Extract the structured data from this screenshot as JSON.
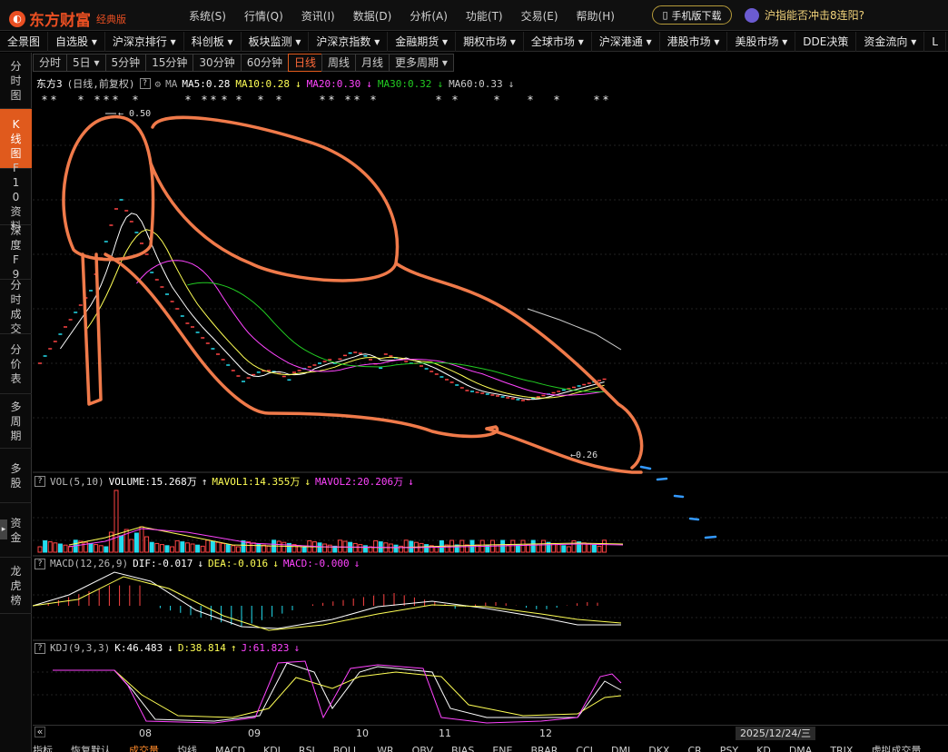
{
  "app": {
    "logo": "东方财富",
    "logo_sub": "经典版"
  },
  "menu": [
    "系统(S)",
    "行情(Q)",
    "资讯(I)",
    "数据(D)",
    "分析(A)",
    "功能(T)",
    "交易(E)",
    "帮助(H)"
  ],
  "mobile_download": "手机版下载",
  "news_headline": "沪指能否冲击8连阳?",
  "navbar": [
    "全景图",
    "自选股 ▾",
    "沪深京排行 ▾",
    "科创板 ▾",
    "板块监测 ▾",
    "沪深京指数 ▾",
    "金融期货 ▾",
    "期权市场 ▾",
    "全球市场 ▾",
    "沪深港通 ▾",
    "港股市场 ▾",
    "美股市场 ▾",
    "DDE决策",
    "资金流向 ▾",
    "L"
  ],
  "left_tabs": [
    {
      "label": "分时图",
      "active": false
    },
    {
      "label": "K线图",
      "active": true
    },
    {
      "label": "F10资料",
      "active": false
    },
    {
      "label": "深度F9",
      "active": false
    },
    {
      "label": "分时成交",
      "active": false
    },
    {
      "label": "分价表",
      "active": false
    },
    {
      "label": "多周期",
      "active": false
    },
    {
      "label": "多股",
      "active": false
    },
    {
      "label": "资金",
      "active": false
    },
    {
      "label": "龙虎榜",
      "active": false
    }
  ],
  "periods": [
    {
      "label": "分时",
      "active": false
    },
    {
      "label": "5日 ▾",
      "active": false
    },
    {
      "label": "5分钟",
      "active": false
    },
    {
      "label": "15分钟",
      "active": false
    },
    {
      "label": "30分钟",
      "active": false
    },
    {
      "label": "60分钟",
      "active": false
    },
    {
      "label": "日线",
      "active": true
    },
    {
      "label": "周线",
      "active": false
    },
    {
      "label": "月线",
      "active": false
    },
    {
      "label": "更多周期 ▾",
      "active": false
    }
  ],
  "stock": {
    "name": "东方3",
    "mode": "(日线,前复权)",
    "help": "?",
    "ma_label": "MA",
    "ma": [
      {
        "label": "MA5:0.28",
        "color": "#ffffff",
        "arrow": ""
      },
      {
        "label": "MA10:0.28",
        "color": "#ffff55",
        "arrow": "↓"
      },
      {
        "label": "MA20:0.30",
        "color": "#ff44ff",
        "arrow": "↓"
      },
      {
        "label": "MA30:0.32",
        "color": "#22cc22",
        "arrow": "↓"
      },
      {
        "label": "MA60:0.33",
        "color": "#cccccc",
        "arrow": "↓"
      }
    ]
  },
  "price_labels": {
    "high": "0.50",
    "low": "0.26"
  },
  "price_extremes": {
    "high": 0.5,
    "low": 0.26
  },
  "volume": {
    "label": "VOL(5,10)",
    "volume": "VOLUME:15.268万",
    "volume_arrow": "↑",
    "mavol1": "MAVOL1:14.355万",
    "mavol1_arrow": "↓",
    "mavol2": "MAVOL2:20.206万",
    "mavol2_arrow": "↓"
  },
  "macd": {
    "label": "MACD(12,26,9)",
    "dif": "DIF:-0.017",
    "dif_arrow": "↓",
    "dea": "DEA:-0.016",
    "dea_arrow": "↓",
    "macd": "MACD:-0.000",
    "macd_arrow": "↓"
  },
  "kdj": {
    "label": "KDJ(9,3,3)",
    "k": "K:46.483",
    "k_arrow": "↓",
    "d": "D:38.814",
    "d_arrow": "↑",
    "j": "J:61.823",
    "j_arrow": "↓"
  },
  "months": [
    "08",
    "09",
    "10",
    "11",
    "12"
  ],
  "date": "2025/12/24/三",
  "bottom_tabs": [
    {
      "label": "指标",
      "active": false
    },
    {
      "label": "恢复默认",
      "active": false
    },
    {
      "label": "成交量",
      "active": true
    },
    {
      "label": "均线",
      "active": false
    },
    {
      "label": "MACD",
      "active": false
    },
    {
      "label": "KDJ",
      "active": false
    },
    {
      "label": "RSI",
      "active": false
    },
    {
      "label": "BOLL",
      "active": false
    },
    {
      "label": "WR",
      "active": false
    },
    {
      "label": "OBV",
      "active": false
    },
    {
      "label": "BIAS",
      "active": false
    },
    {
      "label": "ENE",
      "active": false
    },
    {
      "label": "BRAR",
      "active": false
    },
    {
      "label": "CCI",
      "active": false
    },
    {
      "label": "DMI",
      "active": false
    },
    {
      "label": "DKX",
      "active": false
    },
    {
      "label": "CR",
      "active": false
    },
    {
      "label": "PSY",
      "active": false
    },
    {
      "label": "KD",
      "active": false
    },
    {
      "label": "DMA",
      "active": false
    },
    {
      "label": "TRIX",
      "active": false
    },
    {
      "label": "虚拟成交量",
      "active": false
    }
  ],
  "colors": {
    "accent": "#e05a1d",
    "up": "#ff4444",
    "down": "#22ddee",
    "annotation": "#f07a4a",
    "annotation_blue": "#3399ff"
  }
}
